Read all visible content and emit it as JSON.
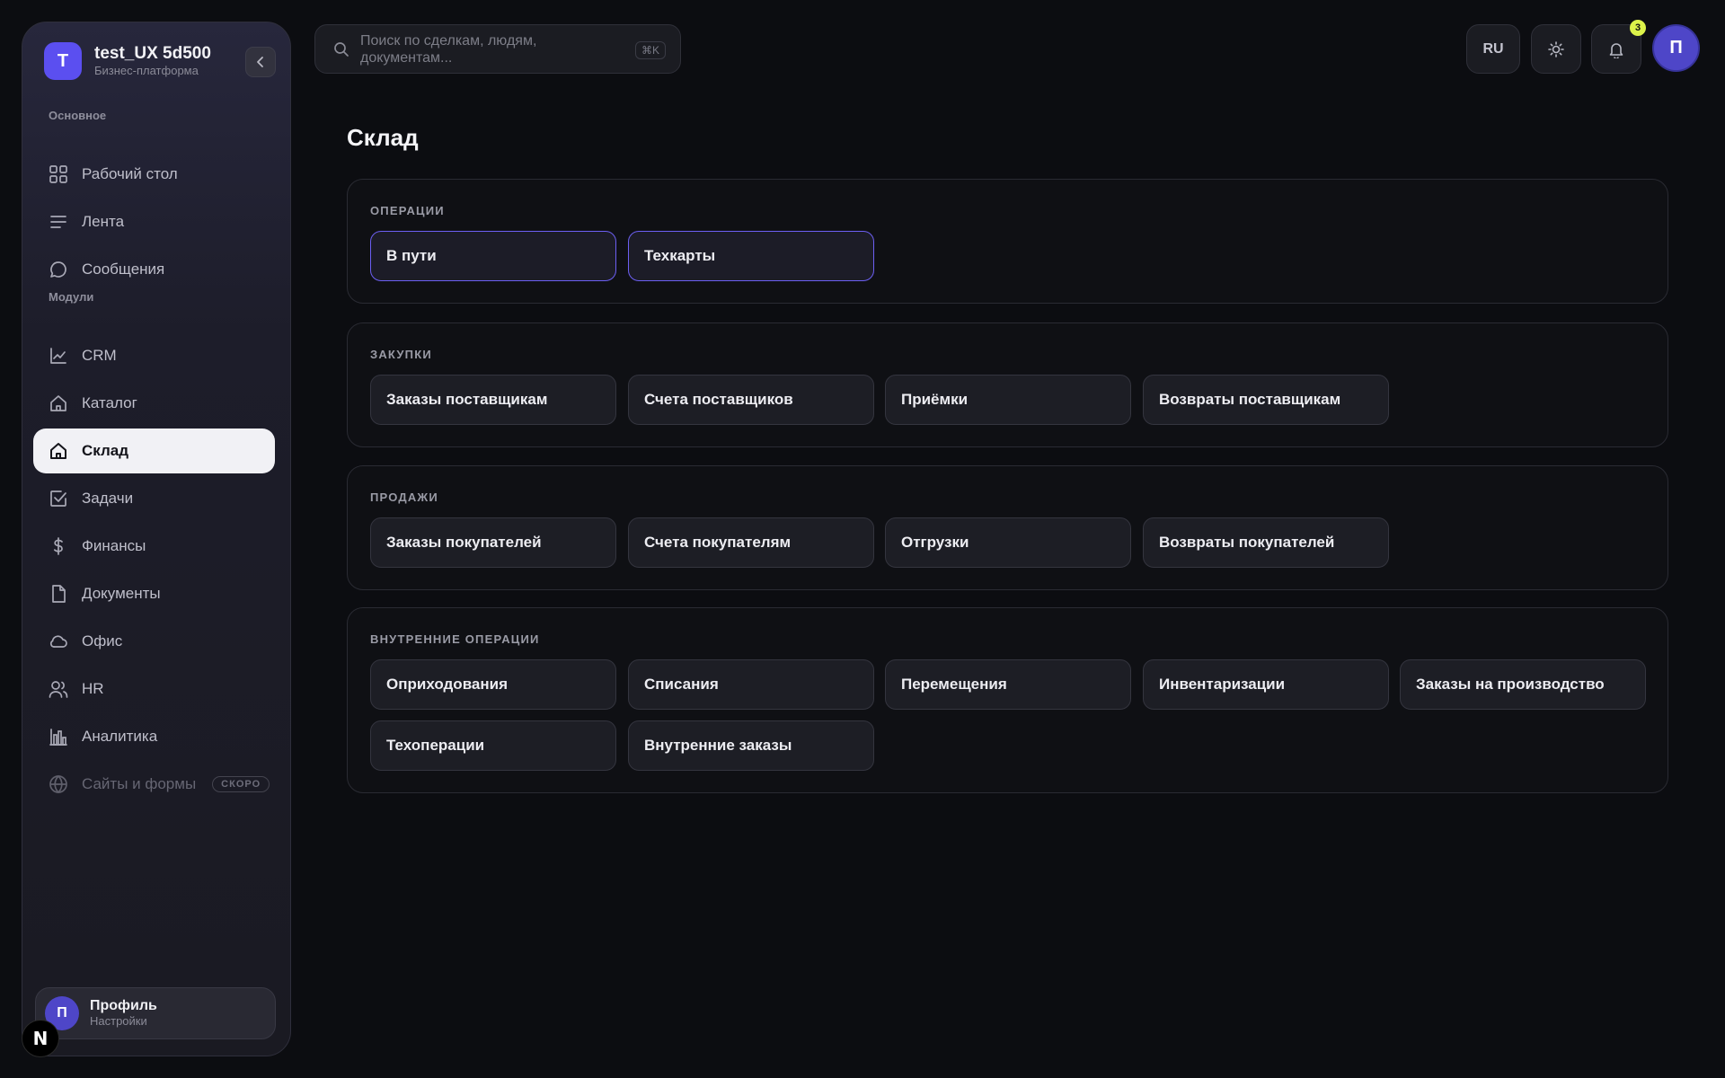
{
  "brand": {
    "logo_letter": "T",
    "name": "test_UX 5d500",
    "subtitle": "Бизнес-платформа"
  },
  "sidebar": {
    "section_main": "Основное",
    "section_modules": "Модули",
    "items": [
      {
        "label": "Рабочий стол",
        "icon": "grid-icon"
      },
      {
        "label": "Лента",
        "icon": "feed-lines-icon"
      },
      {
        "label": "Сообщения",
        "icon": "chat-bubble-icon"
      },
      {
        "label": "CRM",
        "icon": "line-chart-icon"
      },
      {
        "label": "Каталог",
        "icon": "home-icon"
      },
      {
        "label": "Склад",
        "icon": "home-icon",
        "active": true
      },
      {
        "label": "Задачи",
        "icon": "checkbox-icon"
      },
      {
        "label": "Финансы",
        "icon": "dollar-icon"
      },
      {
        "label": "Документы",
        "icon": "document-icon"
      },
      {
        "label": "Офис",
        "icon": "cloud-icon"
      },
      {
        "label": "HR",
        "icon": "users-icon"
      },
      {
        "label": "Аналитика",
        "icon": "bar-chart-icon"
      },
      {
        "label": "Сайты и формы",
        "icon": "globe-icon",
        "disabled": true,
        "badge": "СКОРО"
      }
    ],
    "profile": {
      "avatar_letter": "П",
      "name": "Профиль",
      "subtitle": "Настройки"
    }
  },
  "header": {
    "search_placeholder": "Поиск по сделкам, людям, документам...",
    "search_shortcut": "⌘K",
    "lang": "RU",
    "notifications_count": "3",
    "user_avatar_letter": "П"
  },
  "page": {
    "title": "Склад",
    "sections": [
      {
        "title": "ОПЕРАЦИИ",
        "tiles": [
          "В пути",
          "Техкарты"
        ]
      },
      {
        "title": "ЗАКУПКИ",
        "tiles": [
          "Заказы поставщикам",
          "Счета поставщиков",
          "Приёмки",
          "Возвраты поставщикам"
        ]
      },
      {
        "title": "ПРОДАЖИ",
        "tiles": [
          "Заказы покупателей",
          "Счета покупателям",
          "Отгрузки",
          "Возвраты покупателей"
        ]
      },
      {
        "title": "ВНУТРЕННИЕ ОПЕРАЦИИ",
        "tiles": [
          "Оприходования",
          "Списания",
          "Перемещения",
          "Инвентаризации",
          "Заказы на производство",
          "Техоперации",
          "Внутренние заказы"
        ]
      }
    ]
  },
  "colors": {
    "accent": "#5b4ff0",
    "badge": "#dcf24a",
    "background": "#0c0d11"
  }
}
